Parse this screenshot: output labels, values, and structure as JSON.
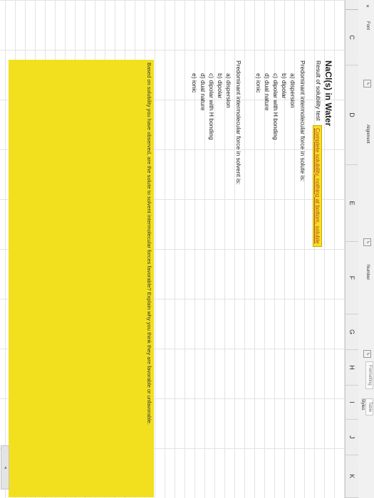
{
  "ribbon": {
    "font_label": "Font",
    "alignment_label": "Alignment",
    "number_label": "Number",
    "styles_label": "Styles",
    "formatting_chip": "Formatting",
    "table_chip": "Table",
    "corner_glyph": "✕",
    "launcher_glyph": "↳"
  },
  "columns": [
    "C",
    "D",
    "E",
    "F",
    "G",
    "H",
    "I",
    "J",
    "K"
  ],
  "sheet": {
    "title": "NaCl(s) in Water",
    "subtitle": "Result of solubility test",
    "note": "Complete solubility, nothing at bottom, soluble",
    "solute_question": "Predominant intermolecular force in solute is:",
    "solute_options": [
      "a) dispersion",
      "b) dipolar",
      "c) dipolar with H bonding",
      "d) dual nature",
      "e) ionic"
    ],
    "solvent_question": "Predominant intermolecular force in solvent is:",
    "solvent_options": [
      "a) dispersion",
      "b) dipolar",
      "c) dipolar with H bonding",
      "d) dual nature",
      "e) ionic"
    ],
    "answer_prompt": "Based on solubility you have observed, are the solute to solvent intermolecular forces favorable? Explain why you think they are favorable or unfavorable."
  },
  "colors": {
    "highlight": "#f2e01f",
    "note_text": "#b7421d"
  },
  "scroll_glyph": "◂"
}
